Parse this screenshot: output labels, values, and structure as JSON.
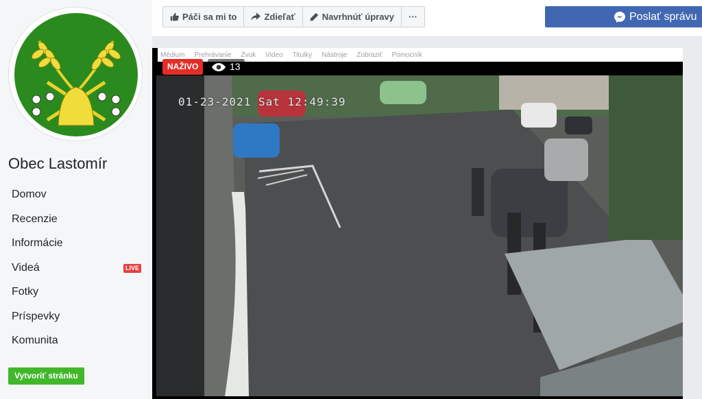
{
  "sidebar": {
    "page_name": "Obec Lastomír",
    "nav": [
      {
        "label": "Domov"
      },
      {
        "label": "Recenzie"
      },
      {
        "label": "Informácie"
      },
      {
        "label": "Videá",
        "badge": "LIVE"
      },
      {
        "label": "Fotky"
      },
      {
        "label": "Príspevky"
      },
      {
        "label": "Komunita"
      }
    ],
    "create_page": "Vytvoriť stránku"
  },
  "toolbar": {
    "like": "Páči sa mi to",
    "share": "Zdieľať",
    "suggest": "Navrhnúť úpravy",
    "more": "···",
    "message": "Poslať správu"
  },
  "player_menu": [
    "Médium",
    "Prehrávanie",
    "Zvuk",
    "Video",
    "Titulky",
    "Nástroje",
    "Zobraziť",
    "Pomocník"
  ],
  "video": {
    "live_label": "NAŽIVO",
    "viewer_count": "13",
    "timestamp": "01-23-2021 Sat 12:49:39"
  },
  "colors": {
    "accent": "#4267b2",
    "live": "#e42d27",
    "create": "#42b72a"
  }
}
